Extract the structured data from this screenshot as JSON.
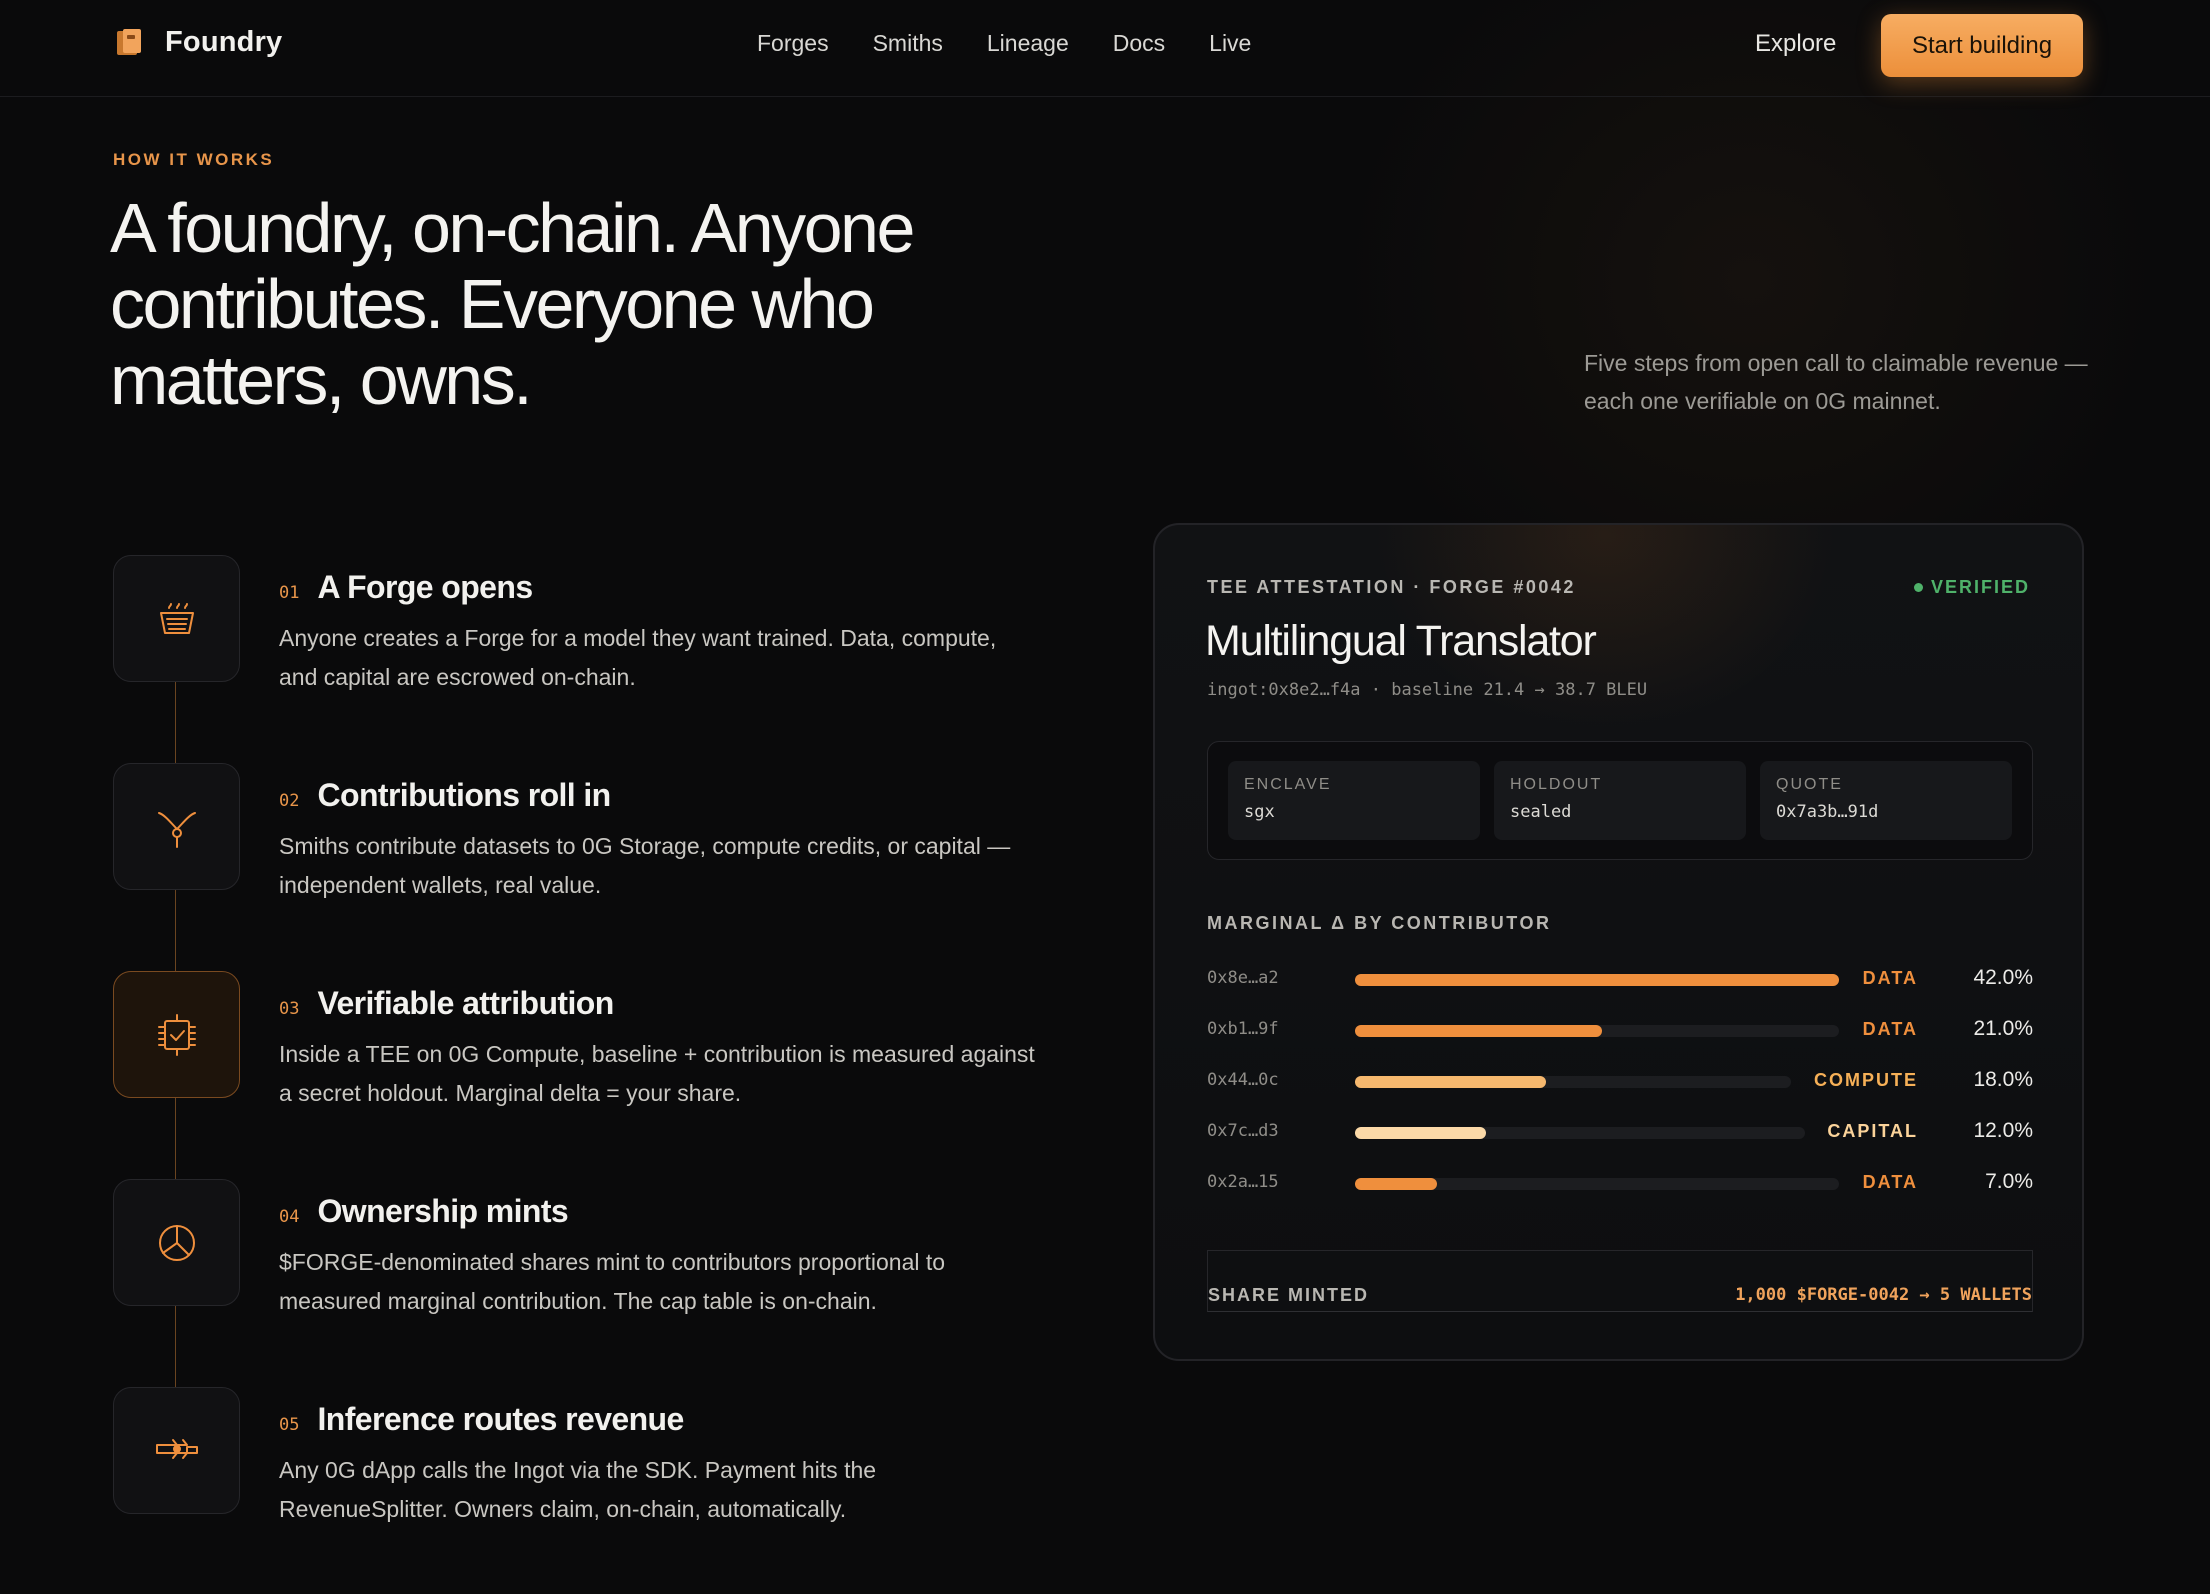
{
  "nav": {
    "brand": "Foundry",
    "links": [
      "Forges",
      "Smiths",
      "Lineage",
      "Docs",
      "Live"
    ],
    "explore": "Explore",
    "cta": "Start building"
  },
  "hero": {
    "eyebrow": "HOW IT WORKS",
    "headline": "A foundry, on-chain. Anyone contributes. Everyone who matters, owns.",
    "subcopy": "Five steps from open call to claimable revenue — each one verifiable on 0G mainnet."
  },
  "steps": [
    {
      "num": "01",
      "title": "A Forge opens",
      "desc": "Anyone creates a Forge for a model they want trained. Data, compute, and capital are escrowed on-chain.",
      "icon": "crucible-icon"
    },
    {
      "num": "02",
      "title": "Contributions roll in",
      "desc": "Smiths contribute datasets to 0G Storage, compute credits, or capital — independent wallets, real value.",
      "icon": "merge-icon"
    },
    {
      "num": "03",
      "title": "Verifiable attribution",
      "desc": "Inside a TEE on 0G Compute, baseline + contribution is measured against a secret holdout. Marginal delta = your share.",
      "icon": "chip-check-icon"
    },
    {
      "num": "04",
      "title": "Ownership mints",
      "desc": "$FORGE-denominated shares mint to contributors proportional to measured marginal contribution. The cap table is on-chain.",
      "icon": "pie-icon"
    },
    {
      "num": "05",
      "title": "Inference routes revenue",
      "desc": "Any 0G dApp calls the Ingot via the SDK. Payment hits the RevenueSplitter. Owners claim, on-chain, automatically.",
      "icon": "route-icon"
    }
  ],
  "card": {
    "eyebrow": "TEE ATTESTATION · FORGE #0042",
    "status": "VERIFIED",
    "title": "Multilingual Translator",
    "meta": "ingot:0x8e2…f4a · baseline 21.4 → 38.7 BLEU",
    "attestation": [
      {
        "label": "ENCLAVE",
        "value": "sgx"
      },
      {
        "label": "HOLDOUT",
        "value": "sealed"
      },
      {
        "label": "QUOTE",
        "value": "0x7a3b…91d"
      }
    ],
    "section_label": "MARGINAL Δ BY CONTRIBUTOR",
    "contributors": [
      {
        "addr": "0x8e…a2",
        "type": "DATA",
        "pct": "42.0%",
        "share": 0.42,
        "color": "#ef8f3d"
      },
      {
        "addr": "0xb1…9f",
        "type": "DATA",
        "pct": "21.0%",
        "share": 0.21,
        "color": "#ef8f3d"
      },
      {
        "addr": "0x44…0c",
        "type": "COMPUTE",
        "pct": "18.0%",
        "share": 0.18,
        "color": "#f6b86e"
      },
      {
        "addr": "0x7c…d3",
        "type": "CAPITAL",
        "pct": "12.0%",
        "share": 0.12,
        "color": "#fbd9a8"
      },
      {
        "addr": "0x2a…15",
        "type": "DATA",
        "pct": "7.0%",
        "share": 0.07,
        "color": "#ef8f3d"
      }
    ],
    "share_label": "SHARE MINTED",
    "share_value": "1,000 $FORGE-0042 → 5 WALLETS"
  },
  "colors": {
    "accent": "#ec8f3a",
    "verified": "#4fb26a",
    "background": "#0a0a0b"
  }
}
